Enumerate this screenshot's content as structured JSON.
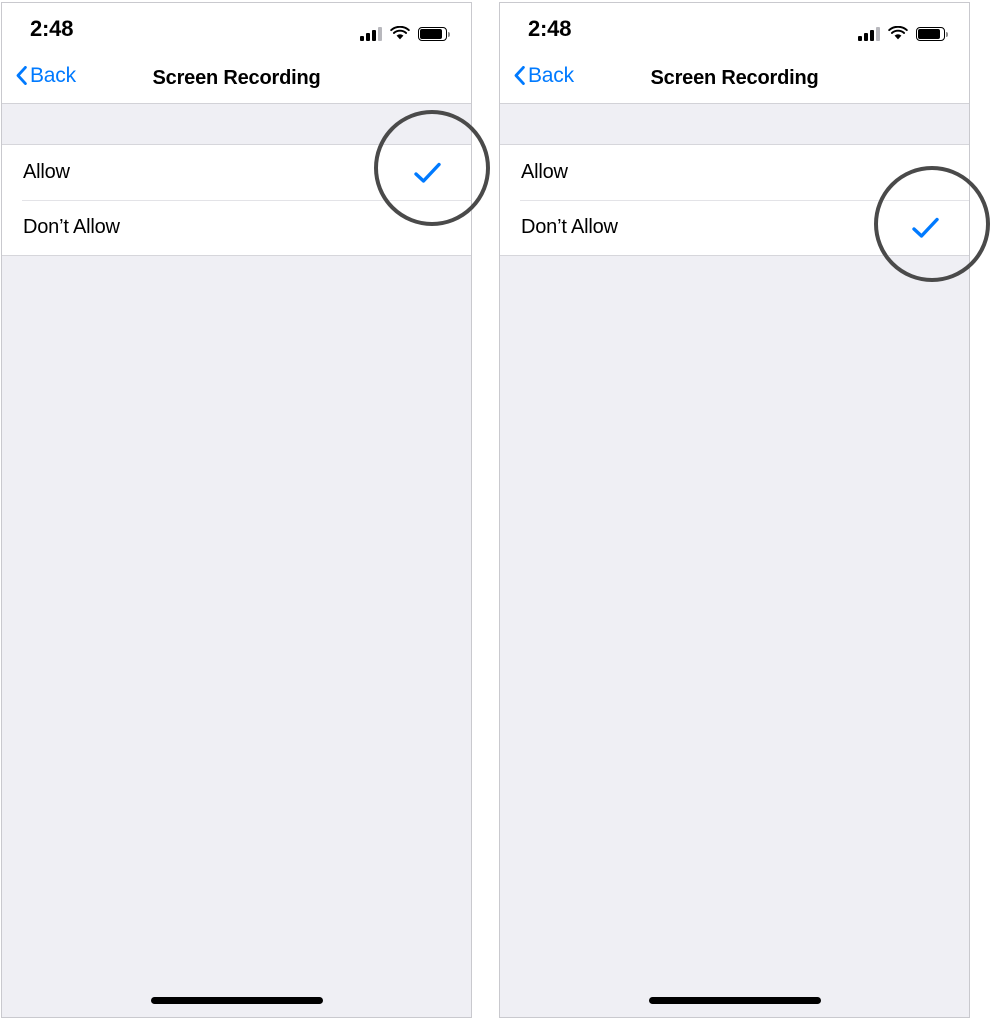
{
  "screens": [
    {
      "id": "screen-allow",
      "status_bar": {
        "time": "2:48",
        "signal_icon": "cellular-signal-icon",
        "wifi_icon": "wifi-icon",
        "battery_icon": "battery-full-icon"
      },
      "nav": {
        "back_label": "Back",
        "back_icon": "chevron-left-icon",
        "title": "Screen Recording"
      },
      "rows": [
        {
          "label": "Allow",
          "checked": true
        },
        {
          "label": "Don’t Allow",
          "checked": false
        }
      ],
      "callout": {
        "target": "Allow",
        "icon": "checkmark-icon"
      }
    },
    {
      "id": "screen-dont-allow",
      "status_bar": {
        "time": "2:48",
        "signal_icon": "cellular-signal-icon",
        "wifi_icon": "wifi-icon",
        "battery_icon": "battery-full-icon"
      },
      "nav": {
        "back_label": "Back",
        "back_icon": "chevron-left-icon",
        "title": "Screen Recording"
      },
      "rows": [
        {
          "label": "Allow",
          "checked": false
        },
        {
          "label": "Don’t Allow",
          "checked": true
        }
      ],
      "callout": {
        "target": "Don’t Allow",
        "icon": "checkmark-icon"
      }
    }
  ],
  "colors": {
    "accent_blue": "#007AFF",
    "page_background": "#EFEFF4",
    "cell_background": "#FFFFFF",
    "separator": "#E3E3E7",
    "callout_ring": "#4A4A4A",
    "text_primary": "#000000"
  }
}
